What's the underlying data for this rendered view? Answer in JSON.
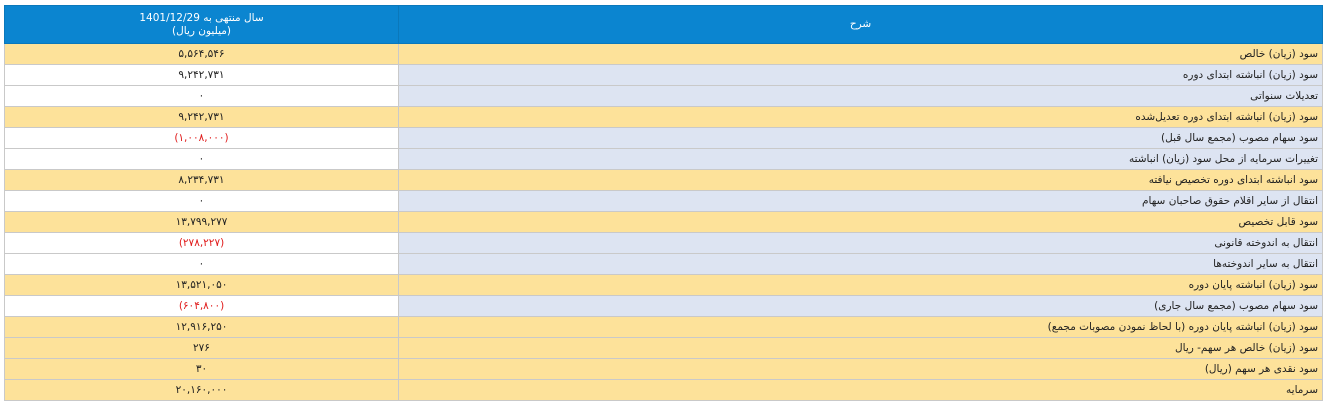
{
  "header": {
    "period_line1": "سال منتهی به 1401/12/29",
    "period_line2": "(میلیون ریال)",
    "description": "شرح"
  },
  "rows": [
    {
      "label": "سود (زیان) خالص",
      "value": "۵,۵۶۴,۵۴۶",
      "negative": false,
      "highlight": true
    },
    {
      "label": "سود (زیان) انباشته ابتدای دوره",
      "value": "۹,۲۴۲,۷۳۱",
      "negative": false,
      "highlight": false
    },
    {
      "label": "تعدیلات سنواتی",
      "value": "۰",
      "negative": false,
      "highlight": false
    },
    {
      "label": "سود (زیان) انباشته ابتدای دوره تعدیل‌شده",
      "value": "۹,۲۴۲,۷۳۱",
      "negative": false,
      "highlight": true
    },
    {
      "label": "سود سهام مصوب (مجمع سال قبل)",
      "value": "(۱,۰۰۸,۰۰۰)",
      "negative": true,
      "highlight": false
    },
    {
      "label": "تغییرات سرمایه از محل سود (زیان) انباشته",
      "value": "۰",
      "negative": false,
      "highlight": false
    },
    {
      "label": "سود انباشته ابتدای دوره تخصیص نیافته",
      "value": "۸,۲۳۴,۷۳۱",
      "negative": false,
      "highlight": true
    },
    {
      "label": "انتقال از سایر اقلام حقوق صاحبان سهام",
      "value": "۰",
      "negative": false,
      "highlight": false
    },
    {
      "label": "سود قابل تخصیص",
      "value": "۱۳,۷۹۹,۲۷۷",
      "negative": false,
      "highlight": true
    },
    {
      "label": "انتقال به اندوخته قانونی",
      "value": "(۲۷۸,۲۲۷)",
      "negative": true,
      "highlight": false
    },
    {
      "label": "انتقال به سایر اندوخته‌ها",
      "value": "۰",
      "negative": false,
      "highlight": false
    },
    {
      "label": "سود (زیان) انباشته پایان دوره",
      "value": "۱۳,۵۲۱,۰۵۰",
      "negative": false,
      "highlight": true
    },
    {
      "label": "سود سهام مصوب (مجمع سال جاری)",
      "value": "(۶۰۴,۸۰۰)",
      "negative": true,
      "highlight": false
    },
    {
      "label": "سود (زیان) انباشته پایان دوره (با لحاظ نمودن مصوبات مجمع)",
      "value": "۱۲,۹۱۶,۲۵۰",
      "negative": false,
      "highlight": true
    },
    {
      "label": "سود (زیان) خالص هر سهم- ریال",
      "value": "۲۷۶",
      "negative": false,
      "highlight": true
    },
    {
      "label": "سود نقدی هر سهم (ریال)",
      "value": "۳۰",
      "negative": false,
      "highlight": true
    },
    {
      "label": "سرمایه",
      "value": "۲۰,۱۶۰,۰۰۰",
      "negative": false,
      "highlight": true
    }
  ]
}
